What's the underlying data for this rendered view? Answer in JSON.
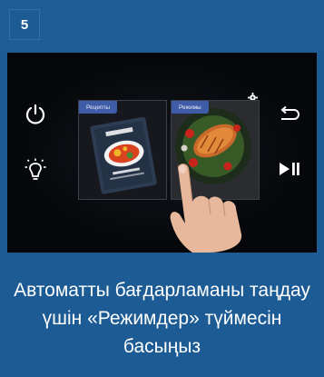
{
  "step": {
    "number": "5"
  },
  "device": {
    "icons": {
      "power": "power-icon",
      "light": "lightbulb-icon",
      "back": "back-arrow-icon",
      "play_pause": "play-pause-icon",
      "settings": "gear-icon"
    },
    "screens": {
      "recipes_tab": "Рецепты",
      "modes_tab": "Режимы"
    }
  },
  "caption": {
    "text": "Автоматты бағдарламаны таңдау үшін «Режимдер» түймесін басыңыз"
  },
  "colors": {
    "brand_blue": "#1c5b94",
    "panel_dark": "#05070a",
    "tab_blue": "#3f5ca8"
  }
}
